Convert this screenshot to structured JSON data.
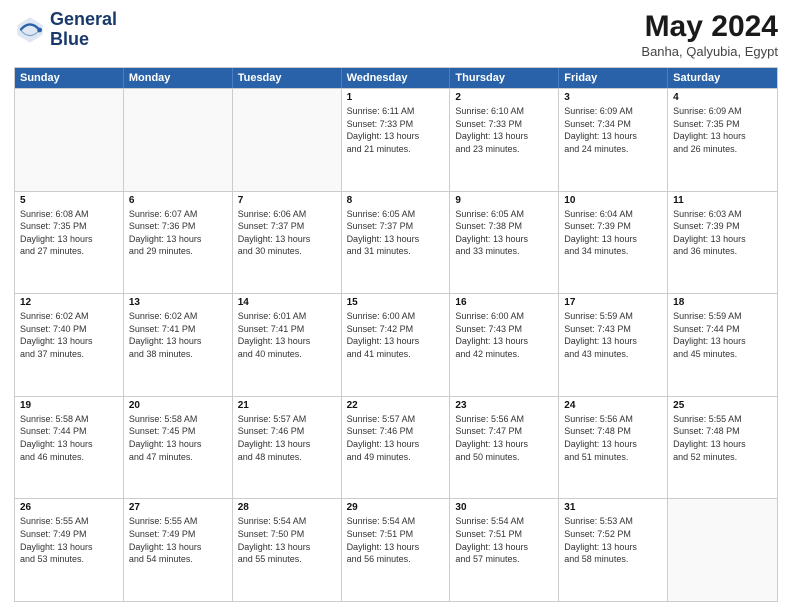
{
  "header": {
    "logo_line1": "General",
    "logo_line2": "Blue",
    "month_year": "May 2024",
    "location": "Banha, Qalyubia, Egypt"
  },
  "weekdays": [
    "Sunday",
    "Monday",
    "Tuesday",
    "Wednesday",
    "Thursday",
    "Friday",
    "Saturday"
  ],
  "rows": [
    [
      {
        "day": "",
        "info": ""
      },
      {
        "day": "",
        "info": ""
      },
      {
        "day": "",
        "info": ""
      },
      {
        "day": "1",
        "info": "Sunrise: 6:11 AM\nSunset: 7:33 PM\nDaylight: 13 hours\nand 21 minutes."
      },
      {
        "day": "2",
        "info": "Sunrise: 6:10 AM\nSunset: 7:33 PM\nDaylight: 13 hours\nand 23 minutes."
      },
      {
        "day": "3",
        "info": "Sunrise: 6:09 AM\nSunset: 7:34 PM\nDaylight: 13 hours\nand 24 minutes."
      },
      {
        "day": "4",
        "info": "Sunrise: 6:09 AM\nSunset: 7:35 PM\nDaylight: 13 hours\nand 26 minutes."
      }
    ],
    [
      {
        "day": "5",
        "info": "Sunrise: 6:08 AM\nSunset: 7:35 PM\nDaylight: 13 hours\nand 27 minutes."
      },
      {
        "day": "6",
        "info": "Sunrise: 6:07 AM\nSunset: 7:36 PM\nDaylight: 13 hours\nand 29 minutes."
      },
      {
        "day": "7",
        "info": "Sunrise: 6:06 AM\nSunset: 7:37 PM\nDaylight: 13 hours\nand 30 minutes."
      },
      {
        "day": "8",
        "info": "Sunrise: 6:05 AM\nSunset: 7:37 PM\nDaylight: 13 hours\nand 31 minutes."
      },
      {
        "day": "9",
        "info": "Sunrise: 6:05 AM\nSunset: 7:38 PM\nDaylight: 13 hours\nand 33 minutes."
      },
      {
        "day": "10",
        "info": "Sunrise: 6:04 AM\nSunset: 7:39 PM\nDaylight: 13 hours\nand 34 minutes."
      },
      {
        "day": "11",
        "info": "Sunrise: 6:03 AM\nSunset: 7:39 PM\nDaylight: 13 hours\nand 36 minutes."
      }
    ],
    [
      {
        "day": "12",
        "info": "Sunrise: 6:02 AM\nSunset: 7:40 PM\nDaylight: 13 hours\nand 37 minutes."
      },
      {
        "day": "13",
        "info": "Sunrise: 6:02 AM\nSunset: 7:41 PM\nDaylight: 13 hours\nand 38 minutes."
      },
      {
        "day": "14",
        "info": "Sunrise: 6:01 AM\nSunset: 7:41 PM\nDaylight: 13 hours\nand 40 minutes."
      },
      {
        "day": "15",
        "info": "Sunrise: 6:00 AM\nSunset: 7:42 PM\nDaylight: 13 hours\nand 41 minutes."
      },
      {
        "day": "16",
        "info": "Sunrise: 6:00 AM\nSunset: 7:43 PM\nDaylight: 13 hours\nand 42 minutes."
      },
      {
        "day": "17",
        "info": "Sunrise: 5:59 AM\nSunset: 7:43 PM\nDaylight: 13 hours\nand 43 minutes."
      },
      {
        "day": "18",
        "info": "Sunrise: 5:59 AM\nSunset: 7:44 PM\nDaylight: 13 hours\nand 45 minutes."
      }
    ],
    [
      {
        "day": "19",
        "info": "Sunrise: 5:58 AM\nSunset: 7:44 PM\nDaylight: 13 hours\nand 46 minutes."
      },
      {
        "day": "20",
        "info": "Sunrise: 5:58 AM\nSunset: 7:45 PM\nDaylight: 13 hours\nand 47 minutes."
      },
      {
        "day": "21",
        "info": "Sunrise: 5:57 AM\nSunset: 7:46 PM\nDaylight: 13 hours\nand 48 minutes."
      },
      {
        "day": "22",
        "info": "Sunrise: 5:57 AM\nSunset: 7:46 PM\nDaylight: 13 hours\nand 49 minutes."
      },
      {
        "day": "23",
        "info": "Sunrise: 5:56 AM\nSunset: 7:47 PM\nDaylight: 13 hours\nand 50 minutes."
      },
      {
        "day": "24",
        "info": "Sunrise: 5:56 AM\nSunset: 7:48 PM\nDaylight: 13 hours\nand 51 minutes."
      },
      {
        "day": "25",
        "info": "Sunrise: 5:55 AM\nSunset: 7:48 PM\nDaylight: 13 hours\nand 52 minutes."
      }
    ],
    [
      {
        "day": "26",
        "info": "Sunrise: 5:55 AM\nSunset: 7:49 PM\nDaylight: 13 hours\nand 53 minutes."
      },
      {
        "day": "27",
        "info": "Sunrise: 5:55 AM\nSunset: 7:49 PM\nDaylight: 13 hours\nand 54 minutes."
      },
      {
        "day": "28",
        "info": "Sunrise: 5:54 AM\nSunset: 7:50 PM\nDaylight: 13 hours\nand 55 minutes."
      },
      {
        "day": "29",
        "info": "Sunrise: 5:54 AM\nSunset: 7:51 PM\nDaylight: 13 hours\nand 56 minutes."
      },
      {
        "day": "30",
        "info": "Sunrise: 5:54 AM\nSunset: 7:51 PM\nDaylight: 13 hours\nand 57 minutes."
      },
      {
        "day": "31",
        "info": "Sunrise: 5:53 AM\nSunset: 7:52 PM\nDaylight: 13 hours\nand 58 minutes."
      },
      {
        "day": "",
        "info": ""
      }
    ]
  ]
}
